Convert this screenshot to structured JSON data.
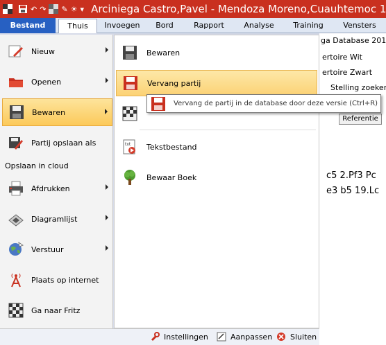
{
  "window": {
    "title": "Arciniega Castro,Pavel - Mendoza Moreno,Cuauhtemoc 1",
    "colors": {
      "titlebar": "#c9301f",
      "file_tab": "#2760c2",
      "highlight": "#fcd275"
    }
  },
  "ribbon": {
    "tabs": [
      "Bestand",
      "Thuis",
      "Invoegen",
      "Bord",
      "Rapport",
      "Analyse",
      "Training",
      "Vensters"
    ]
  },
  "file_menu": {
    "items": [
      {
        "label": "Nieuw",
        "icon": "pencil-icon"
      },
      {
        "label": "Openen",
        "icon": "folder-icon"
      },
      {
        "label": "Bewaren",
        "icon": "floppy-icon"
      },
      {
        "label": "Partij opslaan als",
        "icon": "floppy-pencil-icon"
      },
      {
        "label": "Afdrukken",
        "icon": "printer-icon"
      },
      {
        "label": "Diagramlijst",
        "icon": "chessboard-icon"
      },
      {
        "label": "Verstuur",
        "icon": "globe-icon"
      },
      {
        "label": "Plaats op internet",
        "icon": "antenna-icon"
      },
      {
        "label": "Ga naar Fritz",
        "icon": "chessboard-icon"
      }
    ],
    "cloud_label": "Opslaan in cloud"
  },
  "save_submenu": {
    "items": [
      {
        "label": "Bewaren",
        "icon": "floppy-icon"
      },
      {
        "label": "Vervang partij",
        "icon": "floppy-red-icon"
      },
      {
        "label": "Tekstbestand",
        "icon": "text-file-icon"
      },
      {
        "label": "Bewaar Boek",
        "icon": "tree-icon"
      }
    ]
  },
  "tooltip": {
    "text": "Vervang de partij in de database door deze versie (Ctrl+R)"
  },
  "bottom_bar": {
    "settings": "Instellingen",
    "customize": "Aanpassen",
    "close": "Sluiten"
  },
  "right_panel": {
    "rows": [
      "ga Database 201",
      "ertoire Wit",
      "ertoire Zwart",
      "Stelling zoeken"
    ],
    "ref_button": "Referentie",
    "moves_line1": "c5  2.Pf3  Pc",
    "moves_line2": "e3  b5  19.Lc"
  }
}
